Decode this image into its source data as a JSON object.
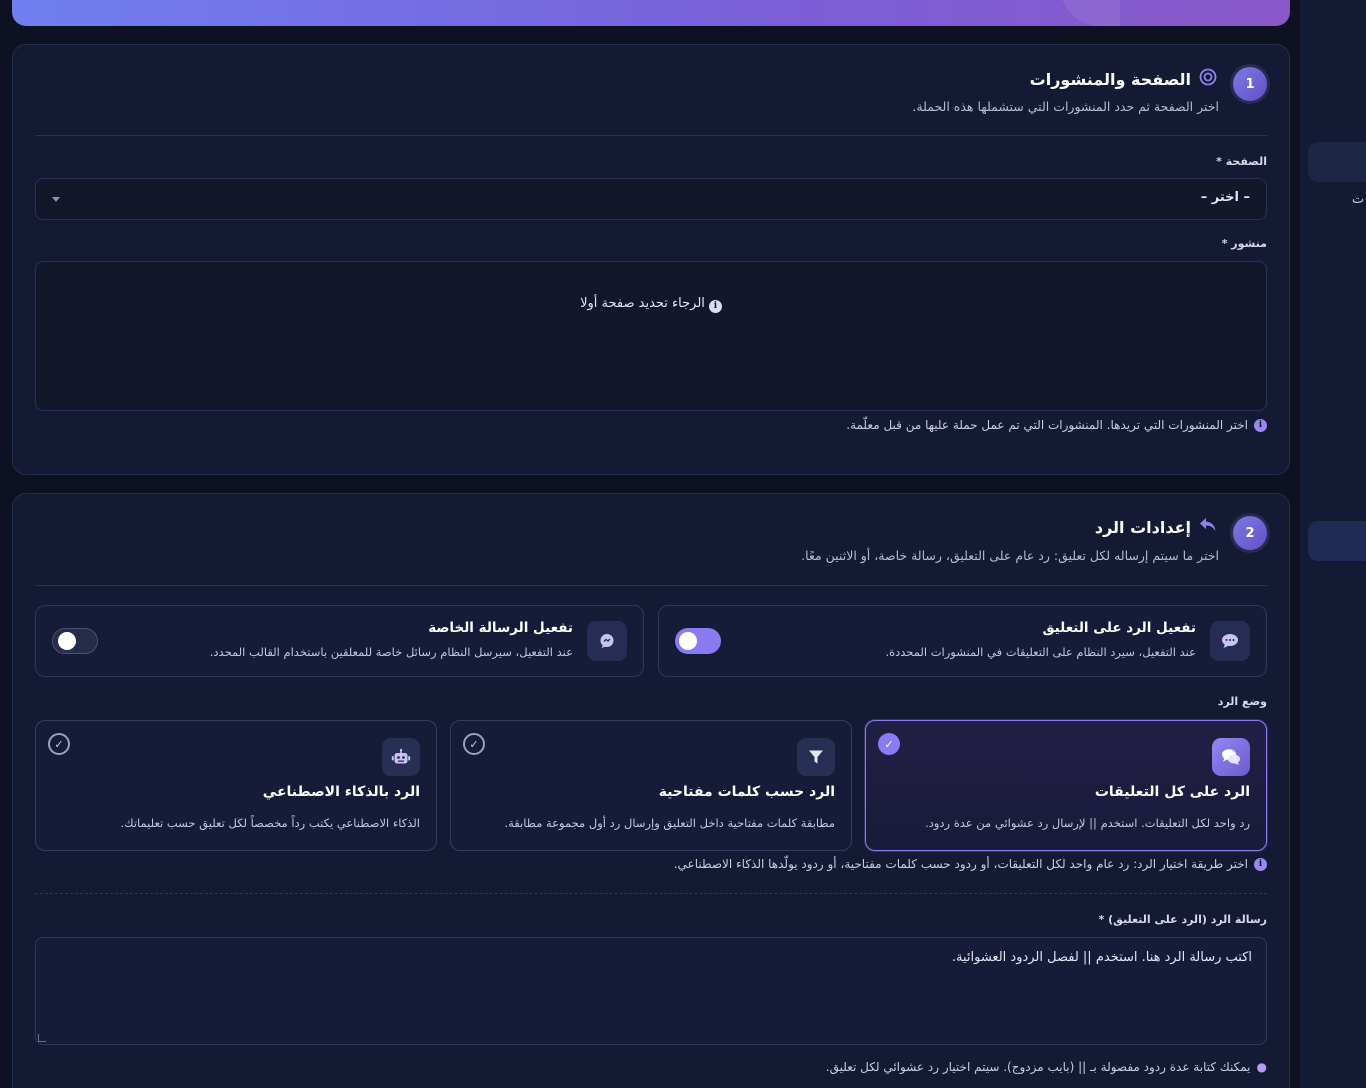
{
  "colors": {
    "accent": "#8a7bf2",
    "background": "#0e1122",
    "card": "#141a33"
  },
  "rail": {
    "fragment": "ت"
  },
  "section1": {
    "step": "1",
    "icon": "target-icon",
    "title": "الصفحة والمنشورات",
    "subtitle": "اختر الصفحة ثم حدد المنشورات التي ستشملها هذه الحملة.",
    "page_label": "الصفحة *",
    "page_select_value": "– اختر –",
    "post_label": "منشور *",
    "post_empty": "الرجاء تحديد صفحة أولا",
    "hint": "اختر المنشورات التي تريدها. المنشورات التي تم عمل حملة عليها من قبل معلّمة."
  },
  "section2": {
    "step": "2",
    "icon": "reply-icon",
    "title": "إعدادات الرد",
    "subtitle": "اختر ما سيتم إرساله لكل تعليق: رد عام على التعليق، رسالة خاصة، أو الاثنين معًا.",
    "comment_toggle": {
      "title": "تفعيل الرد على التعليق",
      "description": "عند التفعيل، سيرد النظام على التعليقات في المنشورات المحددة.",
      "enabled": true
    },
    "dm_toggle": {
      "title": "تفعيل الرسالة الخاصة",
      "description": "عند التفعيل، سيرسل النظام رسائل خاصة للمعلقين باستخدام القالب المحدد.",
      "enabled": false
    },
    "mode_label": "وضع الرد",
    "modes": [
      {
        "icon": "comments-icon",
        "title": "الرد على كل التعليقات",
        "description": "رد واحد لكل التعليقات. استخدم || لإرسال رد عشوائي من عدة ردود.",
        "selected": true
      },
      {
        "icon": "filter-icon",
        "title": "الرد حسب كلمات مفتاحية",
        "description": "مطابقة كلمات مفتاحية داخل التعليق وإرسال رد أول مجموعة مطابقة.",
        "selected": false
      },
      {
        "icon": "robot-icon",
        "title": "الرد بالذكاء الاصطناعي",
        "description": "الذكاء الاصطناعي يكتب رداً مخصصاً لكل تعليق حسب تعليماتك.",
        "selected": false
      }
    ],
    "mode_hint": "اختر طريقة اختيار الرد: رد عام واحد لكل التعليقات، أو ردود حسب كلمات مفتاحية، أو ردود يولّدها الذكاء الاصطناعي.",
    "reply_label": "رسالة الرد (الرد على التعليق) *",
    "reply_placeholder": "اكتب رسالة الرد هنا. استخدم || لفصل الردود العشوائية.",
    "reply_tip": "يمكنك كتابة عدة ردود مفصولة بـ || (بايب مزدوج). سيتم اختيار رد عشوائي لكل تعليق."
  }
}
